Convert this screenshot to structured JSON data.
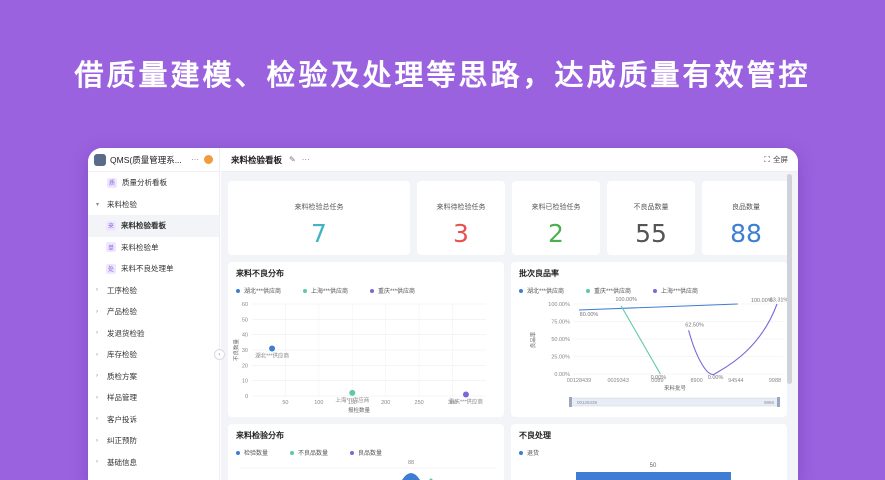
{
  "headline": "借质量建模、检验及处理等思路，达成质量有效管控",
  "app": {
    "title": "QMS(质量管理系...",
    "more": "···"
  },
  "sidebar": {
    "items": [
      {
        "label": "质量分析看板",
        "caret": "",
        "icon": "质"
      },
      {
        "label": "来料检验",
        "caret": "▾",
        "icon": ""
      },
      {
        "label": "来料检验看板",
        "caret": "",
        "icon": "来",
        "sub": true,
        "active": true
      },
      {
        "label": "来料检验单",
        "caret": "",
        "icon": "单",
        "sub": true
      },
      {
        "label": "来料不良处理单",
        "caret": "",
        "icon": "处",
        "sub": true
      },
      {
        "label": "工序检验",
        "caret": "›",
        "icon": ""
      },
      {
        "label": "产品检验",
        "caret": "›",
        "icon": ""
      },
      {
        "label": "发退货检验",
        "caret": "›",
        "icon": ""
      },
      {
        "label": "库存检验",
        "caret": "›",
        "icon": ""
      },
      {
        "label": "质检方案",
        "caret": "›",
        "icon": ""
      },
      {
        "label": "样品管理",
        "caret": "›",
        "icon": ""
      },
      {
        "label": "客户投诉",
        "caret": "›",
        "icon": ""
      },
      {
        "label": "纠正预防",
        "caret": "›",
        "icon": ""
      },
      {
        "label": "基础信息",
        "caret": "›",
        "icon": ""
      }
    ]
  },
  "topbar": {
    "title": "来料检验看板",
    "more": "···",
    "fullscreen": "全屏"
  },
  "kpis": [
    {
      "label": "来料检验总任务",
      "value": "7",
      "color": "#41b4c2"
    },
    {
      "label": "来料待检验任务",
      "value": "3",
      "color": "#e8504f"
    },
    {
      "label": "来料已检验任务",
      "value": "2",
      "color": "#4caf50"
    },
    {
      "label": "不良品数量",
      "value": "55",
      "color": "#555555"
    },
    {
      "label": "良品数量",
      "value": "88",
      "color": "#3d7fd0"
    }
  ],
  "panels": {
    "defect_dist": {
      "title": "来料不良分布",
      "legend": [
        "湖北***供应商",
        "上海***供应商",
        "重庆***供应商"
      ],
      "legend_colors": [
        "#3e7dd3",
        "#5cc9a7",
        "#7b68d6"
      ],
      "ylabel": "不良数量",
      "xlabel": "报检数量"
    },
    "batch_yield": {
      "title": "批次良品率",
      "legend": [
        "湖北***供应商",
        "重庆***供应商",
        "上海***供应商"
      ],
      "legend_colors": [
        "#3e7dd3",
        "#5cc9a7",
        "#7b68d6"
      ],
      "ylabel": "良品率",
      "xlabel": "来料批号",
      "zoom_left": "00128439",
      "zoom_right": "9988"
    },
    "inspect_dist": {
      "title": "来料检验分布",
      "legend": [
        "检验数量",
        "不良品数量",
        "良品数量"
      ],
      "legend_colors": [
        "#3e7dd3",
        "#5cc9a7",
        "#7b68d6"
      ],
      "top_label": "88"
    },
    "defect_handle": {
      "title": "不良处理",
      "legend": [
        "退货"
      ],
      "legend_colors": [
        "#3e7dd3"
      ],
      "bar_value": "50"
    }
  },
  "chart_data": [
    {
      "type": "scatter",
      "title": "来料不良分布",
      "xlabel": "报检数量",
      "ylabel": "不良数量",
      "xlim": [
        0,
        350
      ],
      "ylim": [
        0,
        60
      ],
      "xticks": [
        "50",
        "100",
        "150",
        "200",
        "250",
        "300"
      ],
      "yticks": [
        "0",
        "10",
        "20",
        "30",
        "40",
        "50",
        "60"
      ],
      "series": [
        {
          "name": "湖北***供应商",
          "color": "#3e7dd3",
          "points": [
            [
              30,
              31
            ]
          ],
          "point_labels": [
            "湖北***供应商"
          ]
        },
        {
          "name": "上海***供应商",
          "color": "#5cc9a7",
          "points": [
            [
              150,
              2
            ]
          ],
          "point_labels": [
            "上海***供应商"
          ]
        },
        {
          "name": "重庆***供应商",
          "color": "#7b68d6",
          "points": [
            [
              320,
              1
            ]
          ],
          "point_labels": [
            "重庆***供应商"
          ]
        }
      ]
    },
    {
      "type": "line",
      "title": "批次良品率",
      "xlabel": "来料批号",
      "ylabel": "良品率",
      "categories": [
        "00128439",
        "0029343",
        "0089",
        "8900",
        "94544",
        "9988"
      ],
      "yticks": [
        "0.00%",
        "25.00%",
        "50.00%",
        "75.00%",
        "100.00%"
      ],
      "ylim": [
        0,
        100
      ],
      "series": [
        {
          "name": "湖北***供应商",
          "color": "#3e7dd3",
          "values": [
            80,
            100,
            null,
            null,
            null,
            null
          ]
        },
        {
          "name": "重庆***供应商",
          "color": "#5cc9a7",
          "values": [
            null,
            100,
            0,
            null,
            null,
            null
          ]
        },
        {
          "name": "上海***供应商",
          "color": "#7b68d6",
          "values": [
            null,
            null,
            null,
            62.5,
            0,
            100
          ]
        }
      ],
      "data_labels": [
        "80.00%",
        "100.00%",
        "0.00%",
        "62.50%",
        "0.00%",
        "100.00%",
        "83.31%"
      ]
    }
  ]
}
